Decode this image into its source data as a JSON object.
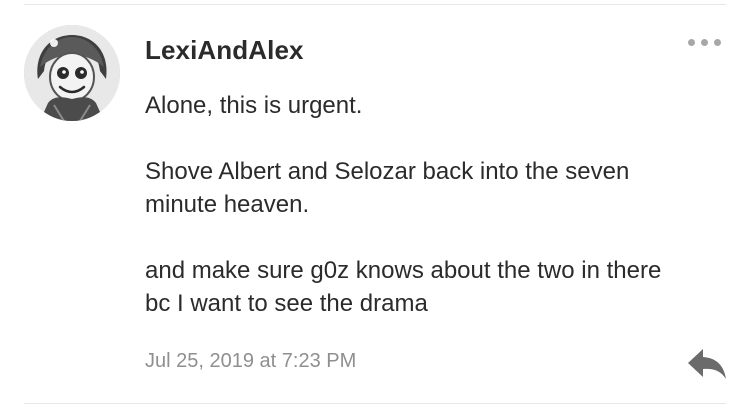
{
  "post": {
    "username": "LexiAndAlex",
    "message_lines": [
      "Alone, this is urgent.",
      "Shove Albert and Selozar back into the seven",
      "minute heaven.",
      "and make sure g0z knows about the two in there",
      "bc I want to see the drama"
    ],
    "timestamp": "Jul 25, 2019 at 7:23 PM"
  },
  "icons": {
    "more": "more-options-icon",
    "reply": "reply-arrow-icon",
    "avatar": "user-avatar"
  },
  "colors": {
    "text": "#2b2b2b",
    "muted": "#8f8f8f",
    "menu_dots": "#a7a7a7",
    "reply_icon": "#6b6b6b"
  }
}
